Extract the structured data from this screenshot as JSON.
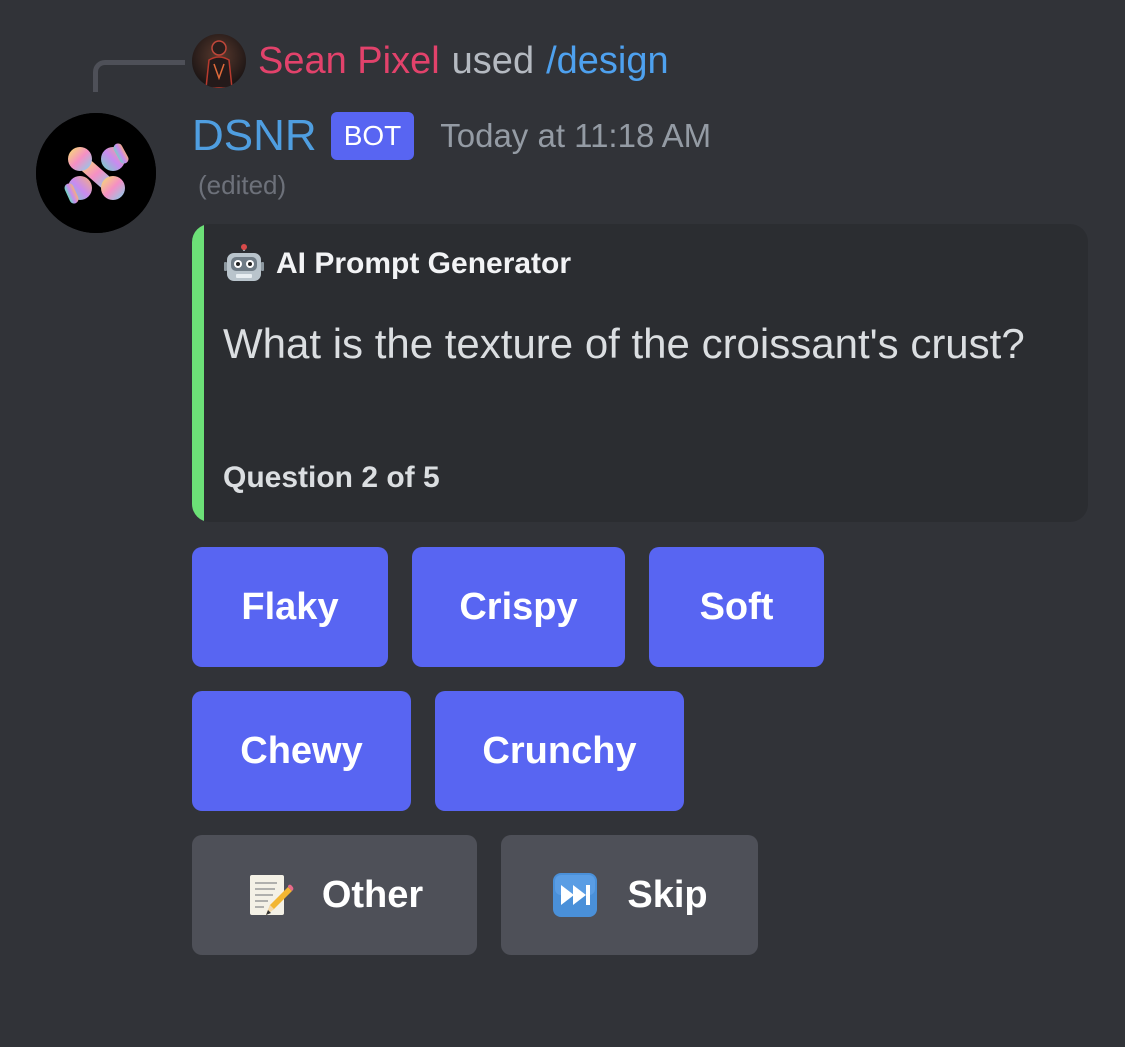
{
  "reply": {
    "user": "Sean Pixel",
    "used": "used",
    "command": "/design"
  },
  "message": {
    "author": "DSNR",
    "tag": "BOT",
    "timestamp": "Today at 11:18 AM",
    "edited": "(edited)"
  },
  "embed": {
    "author": "AI Prompt Generator",
    "author_icon": "robot-icon",
    "description": "What is the texture of the croissant's crust?",
    "footer": "Question 2 of 5",
    "accent_color": "#6ce077"
  },
  "buttons": {
    "row1": [
      "Flaky",
      "Crispy",
      "Soft"
    ],
    "row2": [
      "Chewy",
      "Crunchy"
    ],
    "other": {
      "label": "Other",
      "icon": "memo-icon"
    },
    "skip": {
      "label": "Skip",
      "icon": "next-track-icon"
    }
  },
  "colors": {
    "background": "#313338",
    "embed_background": "#2b2d31",
    "primary_button": "#5865f2",
    "secondary_button": "#4e5058",
    "reply_username": "#e2426b",
    "command": "#4ea1ef",
    "bot_name": "#4f9ee0"
  }
}
